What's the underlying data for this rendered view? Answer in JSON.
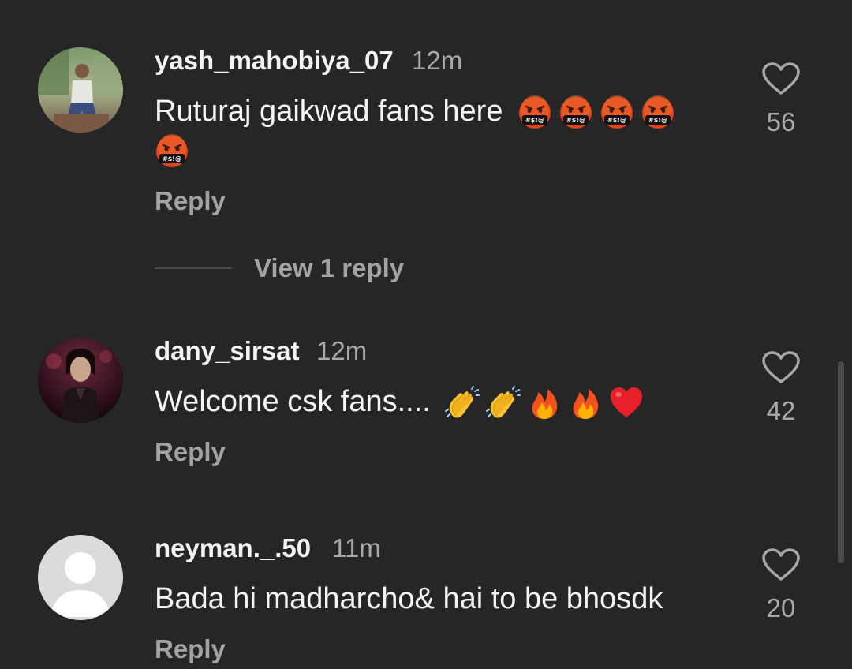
{
  "comments": [
    {
      "username": "yash_mahobiya_07",
      "time": "12m",
      "text": "Ruturaj gaikwad fans here",
      "emojis": [
        "face-with-symbols-on-mouth-icon",
        "face-with-symbols-on-mouth-icon",
        "face-with-symbols-on-mouth-icon",
        "face-with-symbols-on-mouth-icon",
        "face-with-symbols-on-mouth-icon"
      ],
      "reply_label": "Reply",
      "likes": "56",
      "view_replies_label": "View 1 reply"
    },
    {
      "username": "dany_sirsat",
      "time": "12m",
      "text": "Welcome csk fans....",
      "emojis": [
        "clapping-hands-icon",
        "clapping-hands-icon",
        "fire-icon",
        "fire-icon",
        "red-heart-icon"
      ],
      "reply_label": "Reply",
      "likes": "42"
    },
    {
      "username": "neyman._.50",
      "time": "11m",
      "text": "Bada hi madharcho& hai to be bhosdk",
      "reply_label": "Reply",
      "likes": "20"
    }
  ],
  "emoji_glyphs": {
    "symbols_text": "#$!@"
  },
  "colors": {
    "background": "#262626",
    "secondary_text": "#a8a8a8",
    "primary_text": "#f5f5f5"
  }
}
